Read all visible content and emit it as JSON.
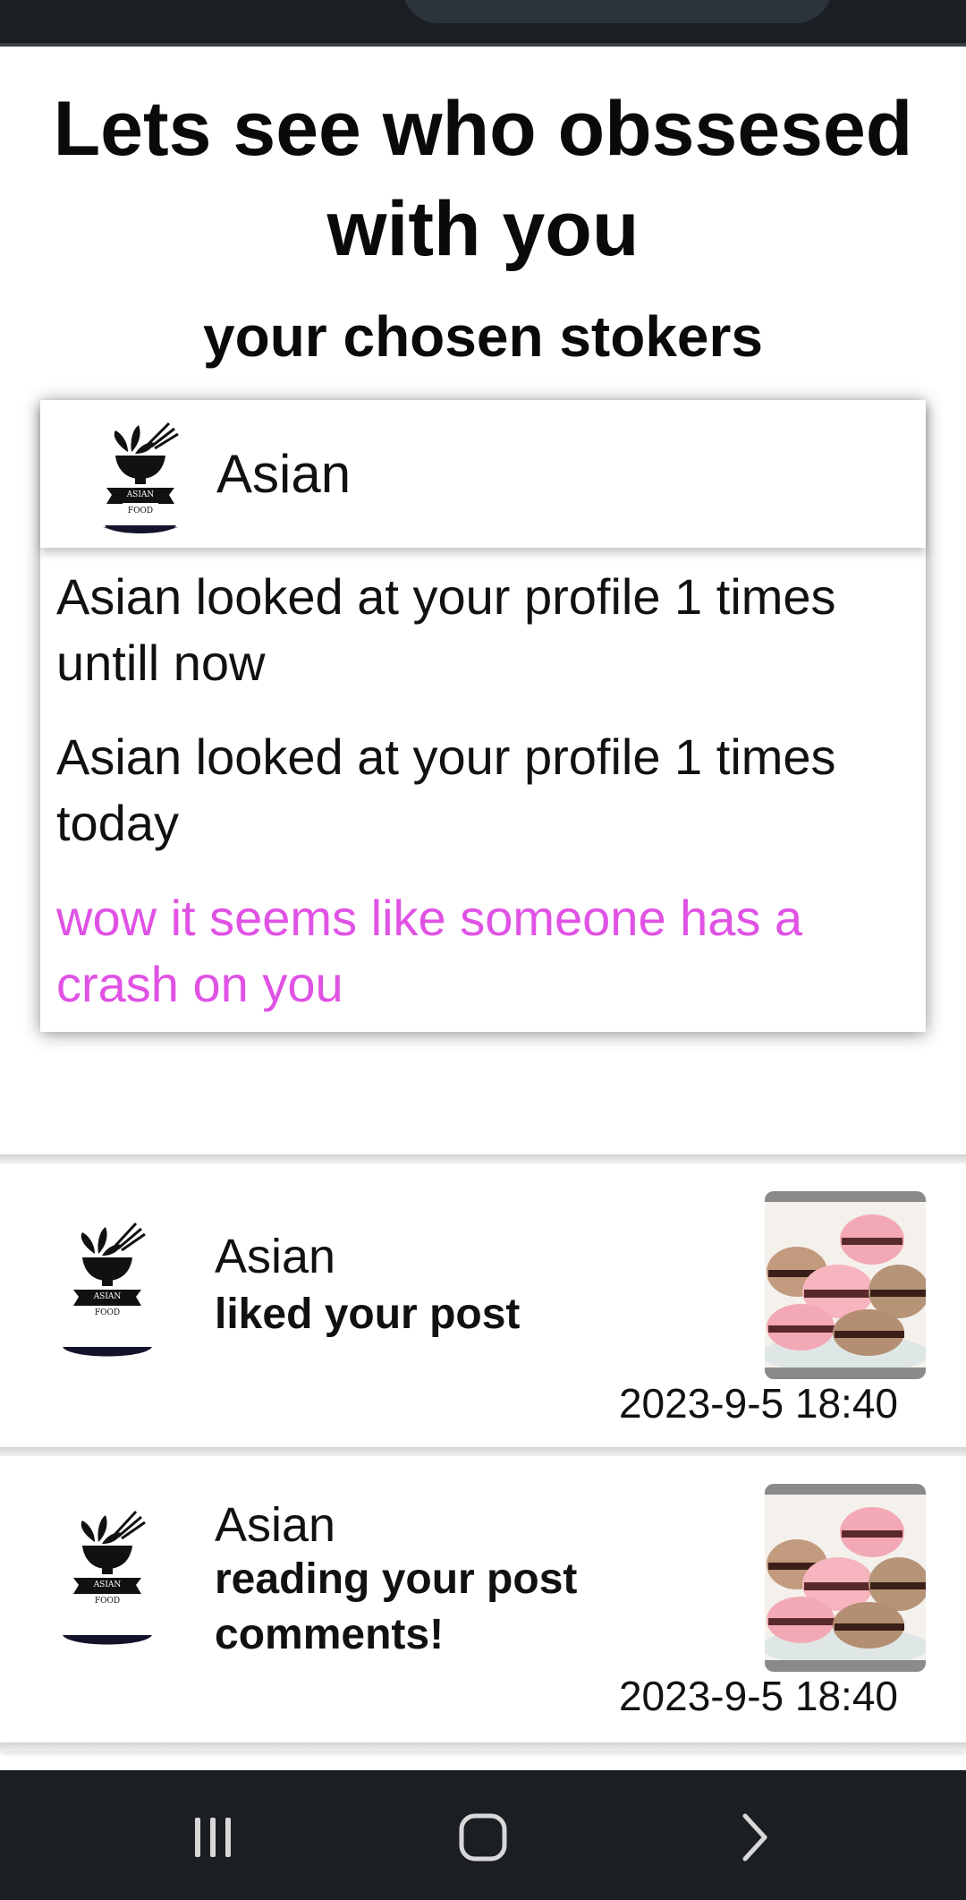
{
  "header": {
    "title": "Lets see who obssesed with you",
    "subtitle": "your chosen stokers"
  },
  "stalker_card": {
    "name": "Asian",
    "avatar_icon": "asian-food-logo-icon",
    "logo_text": [
      "ASIAN",
      "FOOD"
    ],
    "total_views": "Asian looked at your profile 1 times untill now",
    "today_views": "Asian looked at your profile 1 times today",
    "message": "wow it seems like someone has a crash on you",
    "message_color": "#e052e4"
  },
  "feed": [
    {
      "name": "Asian",
      "action": "liked your post",
      "timestamp": "2023-9-5 18:40",
      "avatar_icon": "asian-food-logo-icon",
      "thumbnail_icon": "macarons-image"
    },
    {
      "name": "Asian",
      "action": "reading your post comments!",
      "timestamp": "2023-9-5 18:40",
      "avatar_icon": "asian-food-logo-icon",
      "thumbnail_icon": "macarons-image"
    }
  ],
  "navigation": {
    "buttons": [
      "recent-apps-icon",
      "home-icon",
      "back-icon"
    ]
  }
}
